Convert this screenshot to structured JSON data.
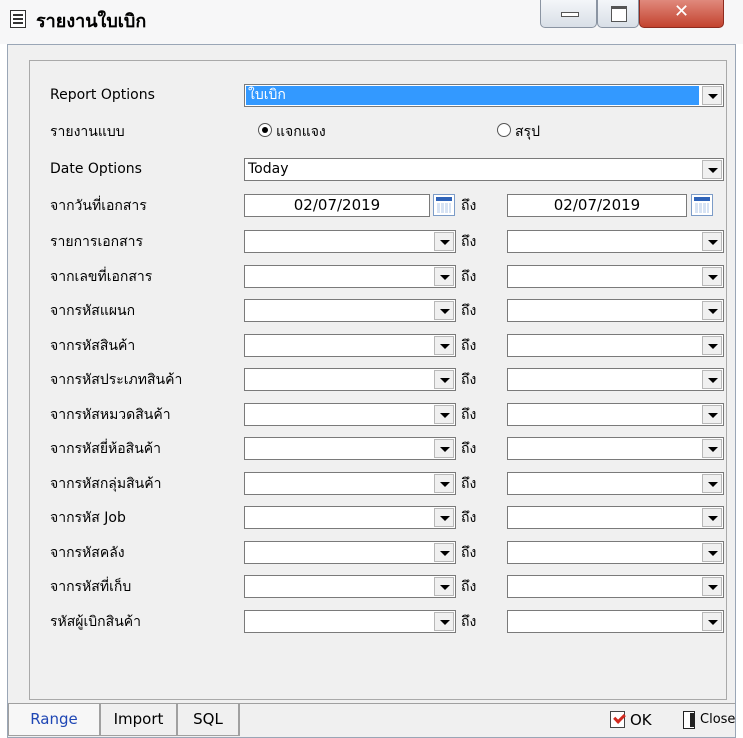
{
  "window": {
    "title": "รายงานใบเบิก"
  },
  "form": {
    "report_options_label": "Report Options",
    "report_options_value": "ใบเบิก",
    "report_type_label": "รายงานแบบ",
    "radio_detail": "แจกแจง",
    "radio_summary": "สรุป",
    "date_options_label": "Date Options",
    "date_options_value": "Today",
    "from_doc_date_label": "จากวันที่เอกสาร",
    "date_from": "02/07/2019",
    "date_to": "02/07/2019",
    "to_label": "ถึง",
    "rows": [
      "รายการเอกสาร",
      "จากเลขที่เอกสาร",
      "จากรหัสแผนก",
      "จากรหัสสินค้า",
      "จากรหัสประเภทสินค้า",
      "จากรหัสหมวดสินค้า",
      "จากรหัสยี่ห้อสินค้า",
      "จากรหัสกลุ่มสินค้า",
      "จากรหัส Job",
      "จากรหัสคลัง",
      "จากรหัสที่เก็บ",
      "รหัสผู้เบิกสินค้า"
    ]
  },
  "footer": {
    "tabs": [
      "Range",
      "Import",
      "SQL"
    ],
    "ok_label": "OK",
    "close_label": "Close"
  }
}
